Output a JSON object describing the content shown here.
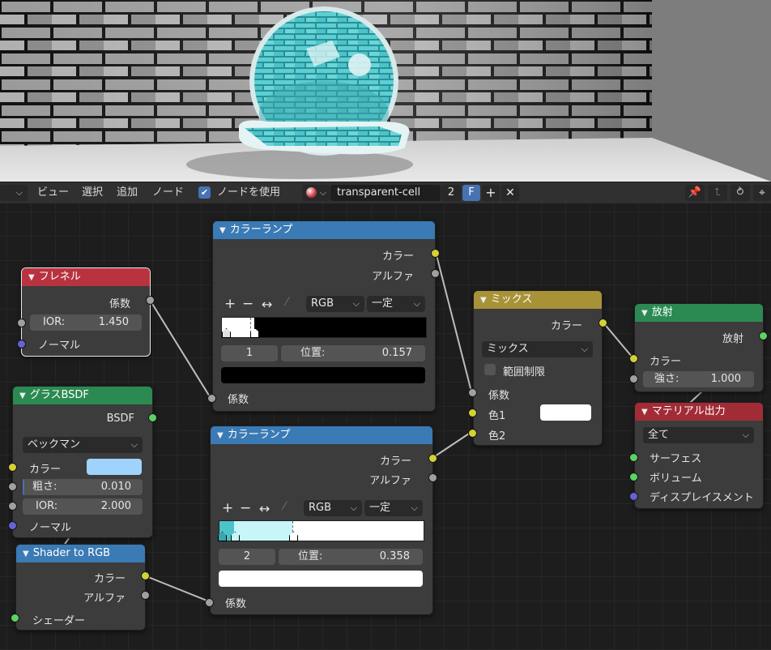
{
  "header": {
    "menu_view": "ビュー",
    "menu_select": "選択",
    "menu_add": "追加",
    "menu_node": "ノード",
    "use_nodes_label": "ノードを使用",
    "use_nodes_checked": true,
    "material_name": "transparent-cell",
    "user_count": "2",
    "fake_user": "F"
  },
  "nodes": {
    "fresnel": {
      "title": "フレネル",
      "out_fac": "係数",
      "ior_label": "IOR:",
      "ior_value": "1.450",
      "in_normal": "ノーマル"
    },
    "glass": {
      "title": "グラスBSDF",
      "out_bsdf": "BSDF",
      "distribution": "ベックマン",
      "color_label": "カラー",
      "color_value": "#9fd3fb",
      "rough_label": "粗さ:",
      "rough_value": "0.010",
      "ior_label": "IOR:",
      "ior_value": "2.000",
      "in_normal": "ノーマル"
    },
    "shader_rgb": {
      "title": "Shader to RGB",
      "out_color": "カラー",
      "out_alpha": "アルファ",
      "in_shader": "シェーダー"
    },
    "ramp1": {
      "title": "カラーランプ",
      "out_color": "カラー",
      "out_alpha": "アルファ",
      "btn_add": "+",
      "btn_remove": "−",
      "btn_flip": "↔",
      "color_mode": "RGB",
      "interpolation": "一定",
      "stop_index": "1",
      "pos_label": "位置:",
      "pos_value": "0.157",
      "stop_color": "#000000",
      "in_fac": "係数"
    },
    "ramp2": {
      "title": "カラーランプ",
      "out_color": "カラー",
      "out_alpha": "アルファ",
      "btn_add": "+",
      "btn_remove": "−",
      "btn_flip": "↔",
      "color_mode": "RGB",
      "interpolation": "一定",
      "stop_index": "2",
      "pos_label": "位置:",
      "pos_value": "0.358",
      "stop_color": "#ffffff",
      "in_fac": "係数"
    },
    "mix": {
      "title": "ミックス",
      "out_color": "カラー",
      "blend_mode": "ミックス",
      "clamp_label": "範囲制限",
      "in_fac": "係数",
      "in_color1": "色1",
      "color1_value": "#ffffff",
      "in_color2": "色2"
    },
    "emission": {
      "title": "放射",
      "out_emission": "放射",
      "in_color": "カラー",
      "strength_label": "強さ:",
      "strength_value": "1.000"
    },
    "output": {
      "title": "マテリアル出力",
      "target": "全て",
      "in_surface": "サーフェス",
      "in_volume": "ボリューム",
      "in_displacement": "ディスプレイスメント"
    }
  },
  "colors": {
    "color_node": "#3a7ab5",
    "input_node": "#b9323f",
    "shader_node": "#2b8a52",
    "mix_node": "#a89237",
    "output_node": "#a22c36",
    "socket_color": "#d3d135",
    "socket_float": "#a0a0a0",
    "socket_shader": "#5cd364",
    "socket_vector": "#6762d6",
    "glass_tint": "#4cc3c8"
  }
}
